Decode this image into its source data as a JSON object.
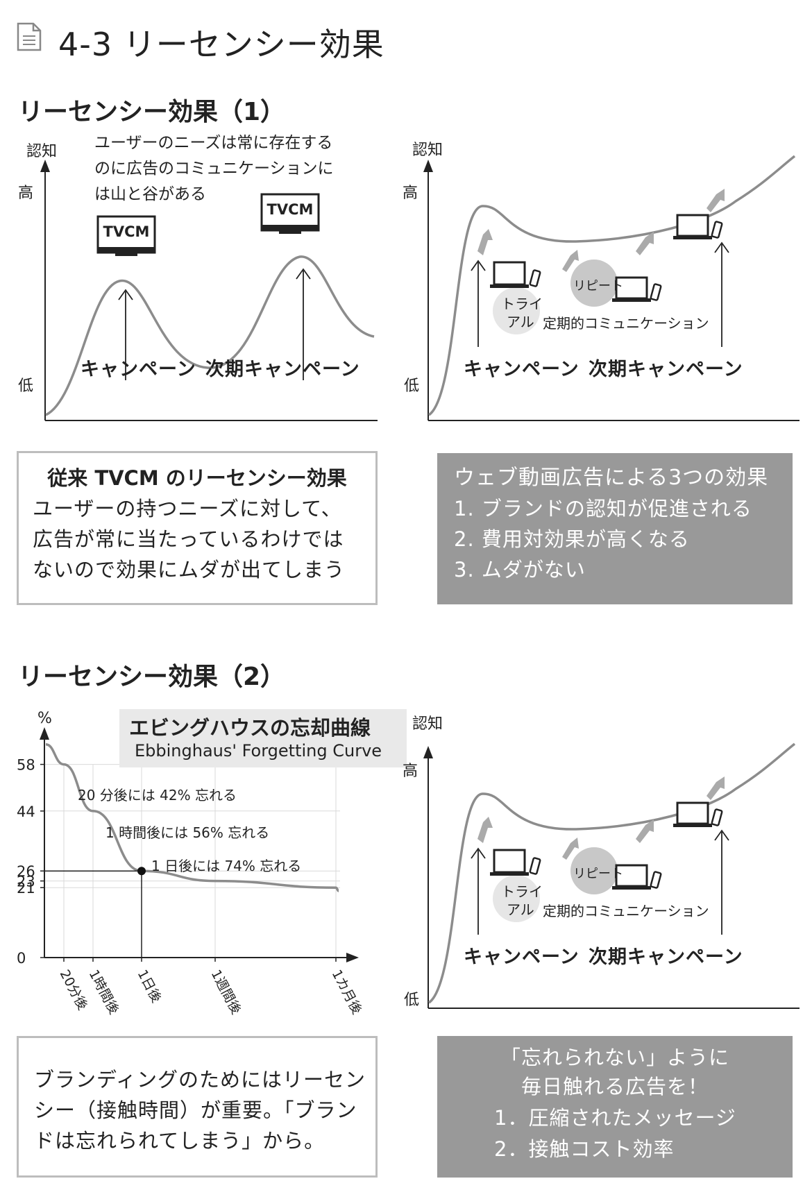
{
  "page": {
    "title": "4-3 リーセンシー効果",
    "icon": "document-icon"
  },
  "section1": {
    "title": "リーセンシー効果（1）",
    "left_chart": {
      "ylabel": "認知",
      "high": "高",
      "low": "低",
      "note": [
        "ユーザーのニーズは常に存在する",
        "のに広告のコミュニケーションに",
        "は山と谷がある"
      ],
      "tv1": "TVCM",
      "tv2": "TVCM",
      "campaign": "キャンペーン",
      "next_campaign": "次期キャンペーン"
    },
    "right_chart": {
      "ylabel": "認知",
      "high": "高",
      "low": "低",
      "trial": [
        "トライ",
        "アル"
      ],
      "repeat": "リピート",
      "regular": "定期的コミュニケーション",
      "campaign": "キャンペーン",
      "next_campaign": "次期キャンペーン"
    },
    "left_box": {
      "title": "従来 TVCM のリーセンシー効果",
      "lines": [
        "ユーザーの持つニーズに対して、",
        "広告が常に当たっているわけでは",
        "ないので効果にムダが出てしまう"
      ]
    },
    "right_box": {
      "title": "ウェブ動画広告による3つの効果",
      "lines": [
        "1. ブランドの認知が促進される",
        "2. 費用対効果が高くなる",
        "3. ムダがない"
      ]
    }
  },
  "section2": {
    "title": "リーセンシー効果（2）",
    "forgetting": {
      "title_ja": "エビングハウスの忘却曲線",
      "title_en": "Ebbinghaus' Forgetting Curve",
      "annotations": [
        "20 分後には 42% 忘れる",
        "1 時間後には 56% 忘れる",
        "1 日後には 74% 忘れる"
      ]
    },
    "right_chart": {
      "ylabel": "認知",
      "high": "高",
      "low": "低",
      "trial": [
        "トライ",
        "アル"
      ],
      "repeat": "リピート",
      "regular": "定期的コミュニケーション",
      "campaign": "キャンペーン",
      "next_campaign": "次期キャンペーン"
    },
    "left_box": {
      "lines": [
        "ブランディングのためにはリーセン",
        "シー（接触時間）が重要。「ブラン",
        "ドは忘れられてしまう」から。"
      ]
    },
    "right_box": {
      "lines": [
        "「忘れられない」ように",
        "毎日触れる広告を！",
        "1．圧縮されたメッセージ",
        "2．接触コスト効率"
      ]
    }
  },
  "chart_data": {
    "type": "line",
    "title": "エビングハウスの忘却曲線",
    "ylabel": "%",
    "yticks": [
      0,
      21,
      23,
      26,
      44,
      58
    ],
    "categories": [
      "20分後",
      "1時間後",
      "1日後",
      "1週間後",
      "1カ月後"
    ],
    "series": [
      {
        "values": [
          58,
          44,
          26,
          23,
          21
        ]
      }
    ],
    "highlight": {
      "category": "1日後",
      "value": 26
    },
    "grid": true,
    "colors": {
      "curve": "#8c8c8c",
      "axis": "#222222",
      "grid": "#d9d9d9"
    }
  }
}
